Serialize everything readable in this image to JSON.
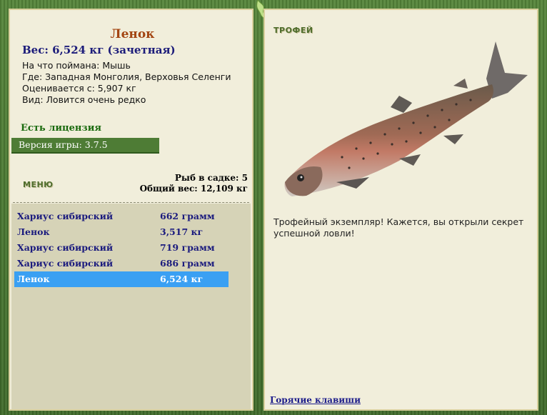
{
  "fish": {
    "name": "Ленок",
    "weight": "Вес: 6,524 кг (зачетная)",
    "bait": "На что поймана: Мышь",
    "location": "Где: Западная Монголия, Верховья Селенги",
    "rated_from": "Оценивается с: 5,907 кг",
    "kind": "Вид: Ловится очень редко"
  },
  "license": "Есть лицензия",
  "version": "Версия игры: 3.7.5",
  "menu": {
    "label": "МЕНЮ",
    "fish_count": "Рыб в садке: 5",
    "total_weight": "Общий вес: 12,109 кг"
  },
  "catch_list": [
    {
      "name": "Хариус сибирский",
      "weight": "662 грамм"
    },
    {
      "name": "Ленок",
      "weight": "3,517 кг"
    },
    {
      "name": "Хариус сибирский",
      "weight": "719 грамм"
    },
    {
      "name": "Хариус сибирский",
      "weight": "686 грамм"
    },
    {
      "name": "Ленок",
      "weight": "6,524 кг",
      "selected": true
    }
  ],
  "trophy": {
    "title": "ТРОФЕЙ",
    "text": "Трофейный экземпляр! Кажется, вы открыли секрет успешной ловли!"
  },
  "hotkeys_link": "Горячие клавиши",
  "colors": {
    "frame": "#4a7a32",
    "panel": "#f1eedb",
    "selected_row": "#3aa0f3",
    "fish_name": "#a34512"
  }
}
